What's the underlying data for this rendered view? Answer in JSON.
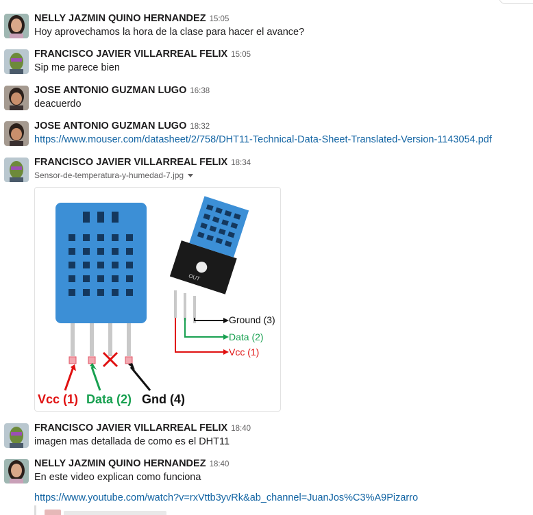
{
  "messages": [
    {
      "author": "NELLY JAZMIN QUINO HERNANDEZ",
      "time": "15:05",
      "text": "Hoy aprovechamos la hora de la clase para hacer el avance?"
    },
    {
      "author": "FRANCISCO JAVIER VILLARREAL FELIX",
      "time": "15:05",
      "text": "Sip me parece bien"
    },
    {
      "author": "JOSE ANTONIO GUZMAN LUGO",
      "time": "16:38",
      "text": "deacuerdo"
    },
    {
      "author": "JOSE ANTONIO GUZMAN LUGO",
      "time": "18:32",
      "link": "https://www.mouser.com/datasheet/2/758/DHT11-Technical-Data-Sheet-Translated-Version-1143054.pdf"
    },
    {
      "author": "FRANCISCO JAVIER VILLARREAL FELIX",
      "time": "18:34",
      "file_name": "Sensor-de-temperatura-y-humedad-7.jpg"
    },
    {
      "author": "FRANCISCO JAVIER VILLARREAL FELIX",
      "time": "18:40",
      "text": "imagen mas detallada de como es el DHT11"
    },
    {
      "author": "NELLY JAZMIN QUINO HERNANDEZ",
      "time": "18:40",
      "text": "En este video explican como funciona",
      "link": "https://www.youtube.com/watch?v=rxVttb3yvRk&ab_channel=JuanJos%C3%A9Pizarro"
    }
  ],
  "diagram": {
    "vcc": "Vcc (1)",
    "data": "Data (2)",
    "gnd": "Gnd (4)",
    "ground3": "Ground (3)",
    "data2": "Data (2)",
    "vcc1": "Vcc (1)",
    "board_mark": "OUT",
    "colors": {
      "sensor": "#3c8fd6",
      "vcc": "#e02020",
      "data": "#18a050",
      "gnd": "#111111"
    }
  }
}
